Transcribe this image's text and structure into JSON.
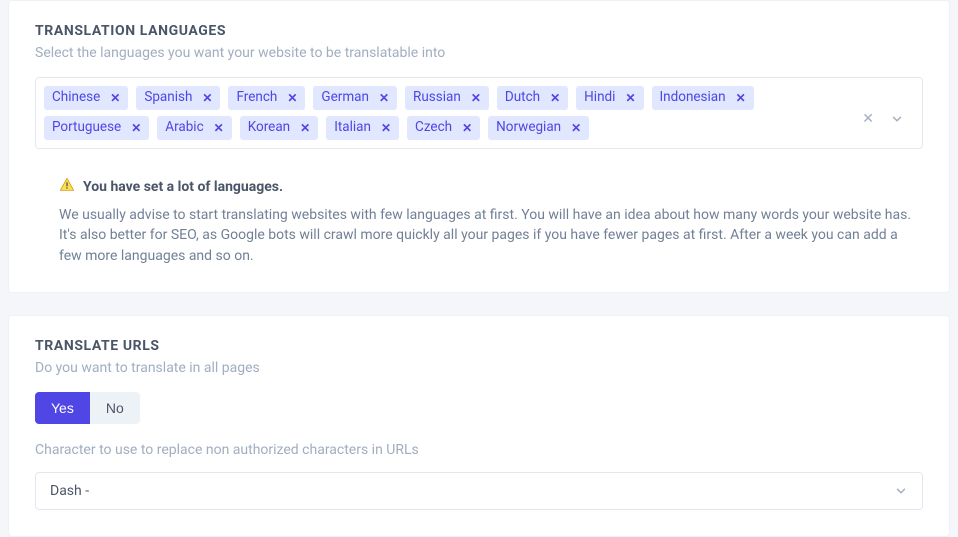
{
  "translation": {
    "title": "TRANSLATION LANGUAGES",
    "subtitle": "Select the languages you want your website to be translatable into",
    "languages": [
      "Chinese",
      "Spanish",
      "French",
      "German",
      "Russian",
      "Dutch",
      "Hindi",
      "Indonesian",
      "Portuguese",
      "Arabic",
      "Korean",
      "Italian",
      "Czech",
      "Norwegian"
    ],
    "warning_title": "You have set a lot of languages.",
    "warning_body": "We usually advise to start translating websites with few languages at first. You will have an idea about how many words your website has. It's also better for SEO, as Google bots will crawl more quickly all your pages if you have fewer pages at first. After a week you can add a few more languages and so on."
  },
  "urls": {
    "title": "TRANSLATE URLS",
    "subtitle": "Do you want to translate in all pages",
    "yes_label": "Yes",
    "no_label": "No",
    "char_label": "Character to use to replace non authorized characters in URLs",
    "char_value": "Dash -"
  }
}
